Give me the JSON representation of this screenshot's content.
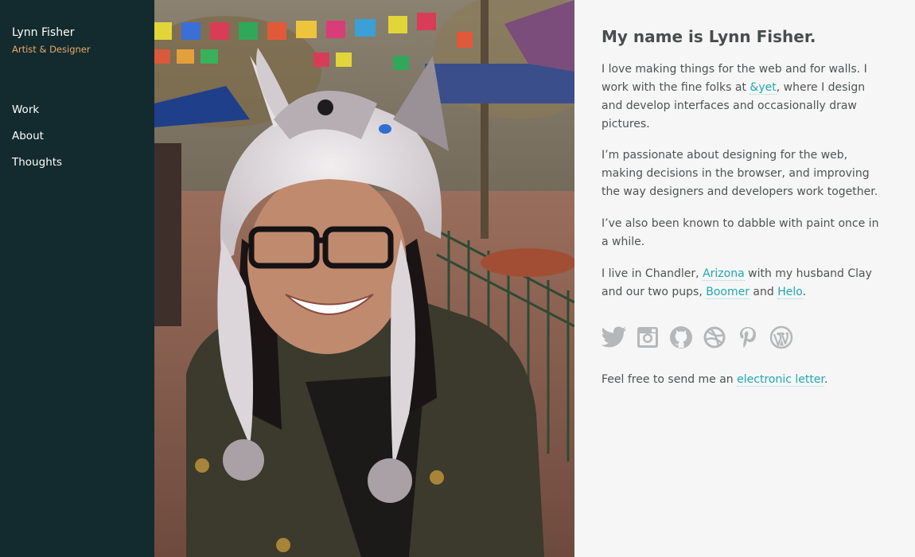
{
  "sidebar": {
    "name": "Lynn Fisher",
    "subtitle": "Artist & Designer",
    "nav": [
      {
        "label": "Work"
      },
      {
        "label": "About"
      },
      {
        "label": "Thoughts"
      }
    ]
  },
  "main": {
    "title": "My name is Lynn Fisher.",
    "p1": {
      "t1": "I love making things for the web and for walls. I work with the fine folks at ",
      "link": "&yet",
      "t2": ", where I design and develop interfaces and occasionally draw pictures."
    },
    "p2": "I’m passionate about designing for the web, making decisions in the browser, and improving the way designers and developers work together.",
    "p3": "I’ve also been known to dabble with paint once in a while.",
    "p4": {
      "t1": "I live in Chandler, ",
      "link1": "Arizona",
      "t2": " with my husband Clay and our two pups, ",
      "link2": "Boomer",
      "t3": " and ",
      "link3": "Helo",
      "t4": "."
    },
    "p5": {
      "t1": "Feel free to send me an ",
      "link": "electronic letter",
      "t2": "."
    },
    "social": [
      {
        "icon": "twitter-icon"
      },
      {
        "icon": "instagram-icon"
      },
      {
        "icon": "github-icon"
      },
      {
        "icon": "dribbble-icon"
      },
      {
        "icon": "pinterest-icon"
      },
      {
        "icon": "wordpress-icon"
      }
    ]
  },
  "colors": {
    "sidebar_bg": "#132b2e",
    "accent_subtitle": "#e8a86a",
    "link": "#1fa8b5",
    "text": "#4f5354",
    "icon": "#b5b7b8",
    "content_bg": "#f6f6f6"
  }
}
